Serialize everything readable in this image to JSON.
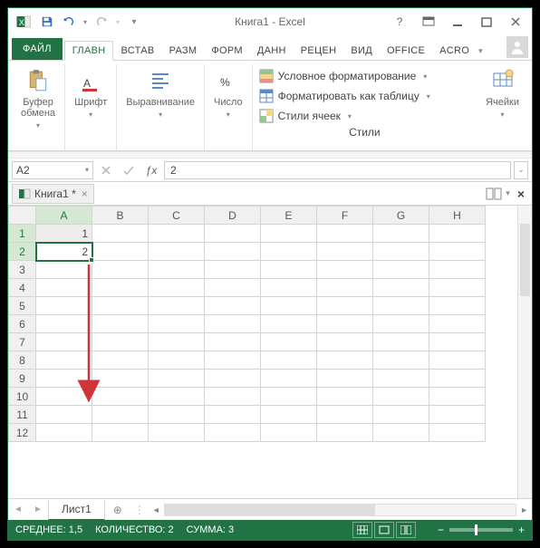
{
  "app": {
    "title": "Книга1 - Excel"
  },
  "qat": {
    "save": "save",
    "undo": "undo",
    "redo": "redo"
  },
  "tabs": {
    "file": "ФАЙЛ",
    "items": [
      "ГЛАВН",
      "ВСТАВ",
      "РАЗМ",
      "ФОРМ",
      "ДАНН",
      "РЕЦЕН",
      "ВИД",
      "OFFICE",
      "ACRO"
    ],
    "active_index": 0
  },
  "ribbon": {
    "clipboard": {
      "label": "Буфер\nобмена"
    },
    "font": {
      "label": "Шрифт"
    },
    "alignment": {
      "label": "Выравнивание"
    },
    "number": {
      "label": "Число"
    },
    "styles": {
      "name": "Стили",
      "conditional": "Условное форматирование",
      "as_table": "Форматировать как таблицу",
      "cell_styles": "Стили ячеек"
    },
    "cells": {
      "label": "Ячейки"
    }
  },
  "formula": {
    "namebox": "A2",
    "value": "2"
  },
  "workbook": {
    "tab": "Книга1 *"
  },
  "grid": {
    "columns": [
      "A",
      "B",
      "C",
      "D",
      "E",
      "F",
      "G",
      "H"
    ],
    "rows": [
      1,
      2,
      3,
      4,
      5,
      6,
      7,
      8,
      9,
      10,
      11,
      12
    ],
    "cells": {
      "A1": "1",
      "A2": "2"
    },
    "selected_col": "A",
    "selected_rows": [
      1,
      2
    ],
    "active_cell": "A2"
  },
  "sheets": {
    "active": "Лист1"
  },
  "status": {
    "average": "СРЕДНЕЕ: 1,5",
    "count": "КОЛИЧЕСТВО: 2",
    "sum": "СУММА: 3"
  }
}
